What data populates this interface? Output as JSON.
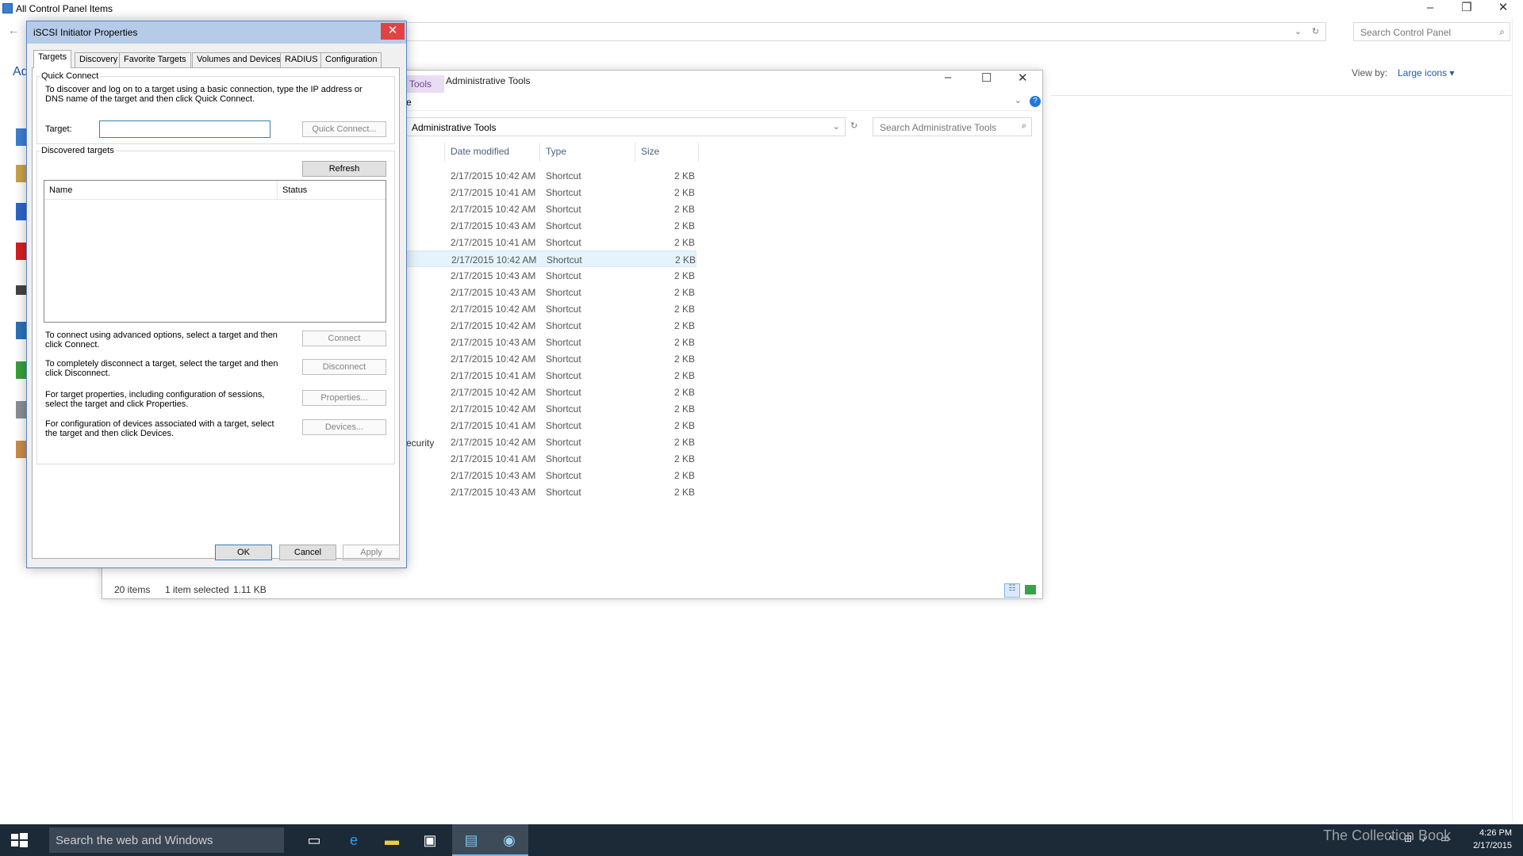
{
  "control_panel": {
    "title": "All Control Panel Items",
    "search_placeholder": "Search Control Panel",
    "heading_fragment": "Ad",
    "view_by_label": "View by:",
    "view_by_value": "Large icons ▾"
  },
  "admin_tools": {
    "ribbon_tab": "Tools",
    "title": "Administrative Tools",
    "ribbon_row_fragment": "e",
    "address": "Administrative Tools",
    "search_placeholder": "Search Administrative Tools",
    "columns": [
      "Date modified",
      "Type",
      "Size"
    ],
    "partial_name_fragment": "ecurity",
    "rows": [
      {
        "date": "2/17/2015 10:42 AM",
        "type": "Shortcut",
        "size": "2 KB"
      },
      {
        "date": "2/17/2015 10:41 AM",
        "type": "Shortcut",
        "size": "2 KB"
      },
      {
        "date": "2/17/2015 10:42 AM",
        "type": "Shortcut",
        "size": "2 KB"
      },
      {
        "date": "2/17/2015 10:43 AM",
        "type": "Shortcut",
        "size": "2 KB"
      },
      {
        "date": "2/17/2015 10:41 AM",
        "type": "Shortcut",
        "size": "2 KB"
      },
      {
        "date": "2/17/2015 10:42 AM",
        "type": "Shortcut",
        "size": "2 KB"
      },
      {
        "date": "2/17/2015 10:43 AM",
        "type": "Shortcut",
        "size": "2 KB"
      },
      {
        "date": "2/17/2015 10:43 AM",
        "type": "Shortcut",
        "size": "2 KB"
      },
      {
        "date": "2/17/2015 10:42 AM",
        "type": "Shortcut",
        "size": "2 KB"
      },
      {
        "date": "2/17/2015 10:42 AM",
        "type": "Shortcut",
        "size": "2 KB"
      },
      {
        "date": "2/17/2015 10:43 AM",
        "type": "Shortcut",
        "size": "2 KB"
      },
      {
        "date": "2/17/2015 10:42 AM",
        "type": "Shortcut",
        "size": "2 KB"
      },
      {
        "date": "2/17/2015 10:41 AM",
        "type": "Shortcut",
        "size": "2 KB"
      },
      {
        "date": "2/17/2015 10:42 AM",
        "type": "Shortcut",
        "size": "2 KB"
      },
      {
        "date": "2/17/2015 10:42 AM",
        "type": "Shortcut",
        "size": "2 KB"
      },
      {
        "date": "2/17/2015 10:41 AM",
        "type": "Shortcut",
        "size": "2 KB"
      },
      {
        "date": "2/17/2015 10:42 AM",
        "type": "Shortcut",
        "size": "2 KB"
      },
      {
        "date": "2/17/2015 10:41 AM",
        "type": "Shortcut",
        "size": "2 KB"
      },
      {
        "date": "2/17/2015 10:43 AM",
        "type": "Shortcut",
        "size": "2 KB"
      },
      {
        "date": "2/17/2015 10:43 AM",
        "type": "Shortcut",
        "size": "2 KB"
      }
    ],
    "selected_row_index": 5,
    "status_items": "20 items",
    "status_selected": "1 item selected",
    "status_size": "1.11 KB"
  },
  "dialog": {
    "title": "iSCSI Initiator Properties",
    "tabs": [
      "Targets",
      "Discovery",
      "Favorite Targets",
      "Volumes and Devices",
      "RADIUS",
      "Configuration"
    ],
    "active_tab": "Targets",
    "quick_connect_label": "Quick Connect",
    "quick_connect_desc": "To discover and log on to a target using a basic connection, type the IP address or DNS name of the target and then click Quick Connect.",
    "target_label": "Target:",
    "target_value": "",
    "quick_connect_button": "Quick Connect...",
    "discovered_label": "Discovered targets",
    "refresh_button": "Refresh",
    "list_headers": [
      "Name",
      "Status"
    ],
    "connect_desc": "To connect using advanced options, select a target and then click Connect.",
    "connect_button": "Connect",
    "disconnect_desc": "To completely disconnect a target, select the target and then click Disconnect.",
    "disconnect_button": "Disconnect",
    "properties_desc": "For target properties, including configuration of sessions, select the target and click Properties.",
    "properties_button": "Properties...",
    "devices_desc": "For configuration of devices associated with a target, select the target and then click Devices.",
    "devices_button": "Devices...",
    "ok": "OK",
    "cancel": "Cancel",
    "apply": "Apply"
  },
  "taskbar": {
    "search_placeholder": "Search the web and Windows",
    "time": "4:26 PM",
    "date": "2/17/2015",
    "watermark": "The Collection Book"
  },
  "colors": {
    "accent": "#1e5aa8",
    "taskbar": "#1c2936",
    "close_red": "#e04343"
  }
}
